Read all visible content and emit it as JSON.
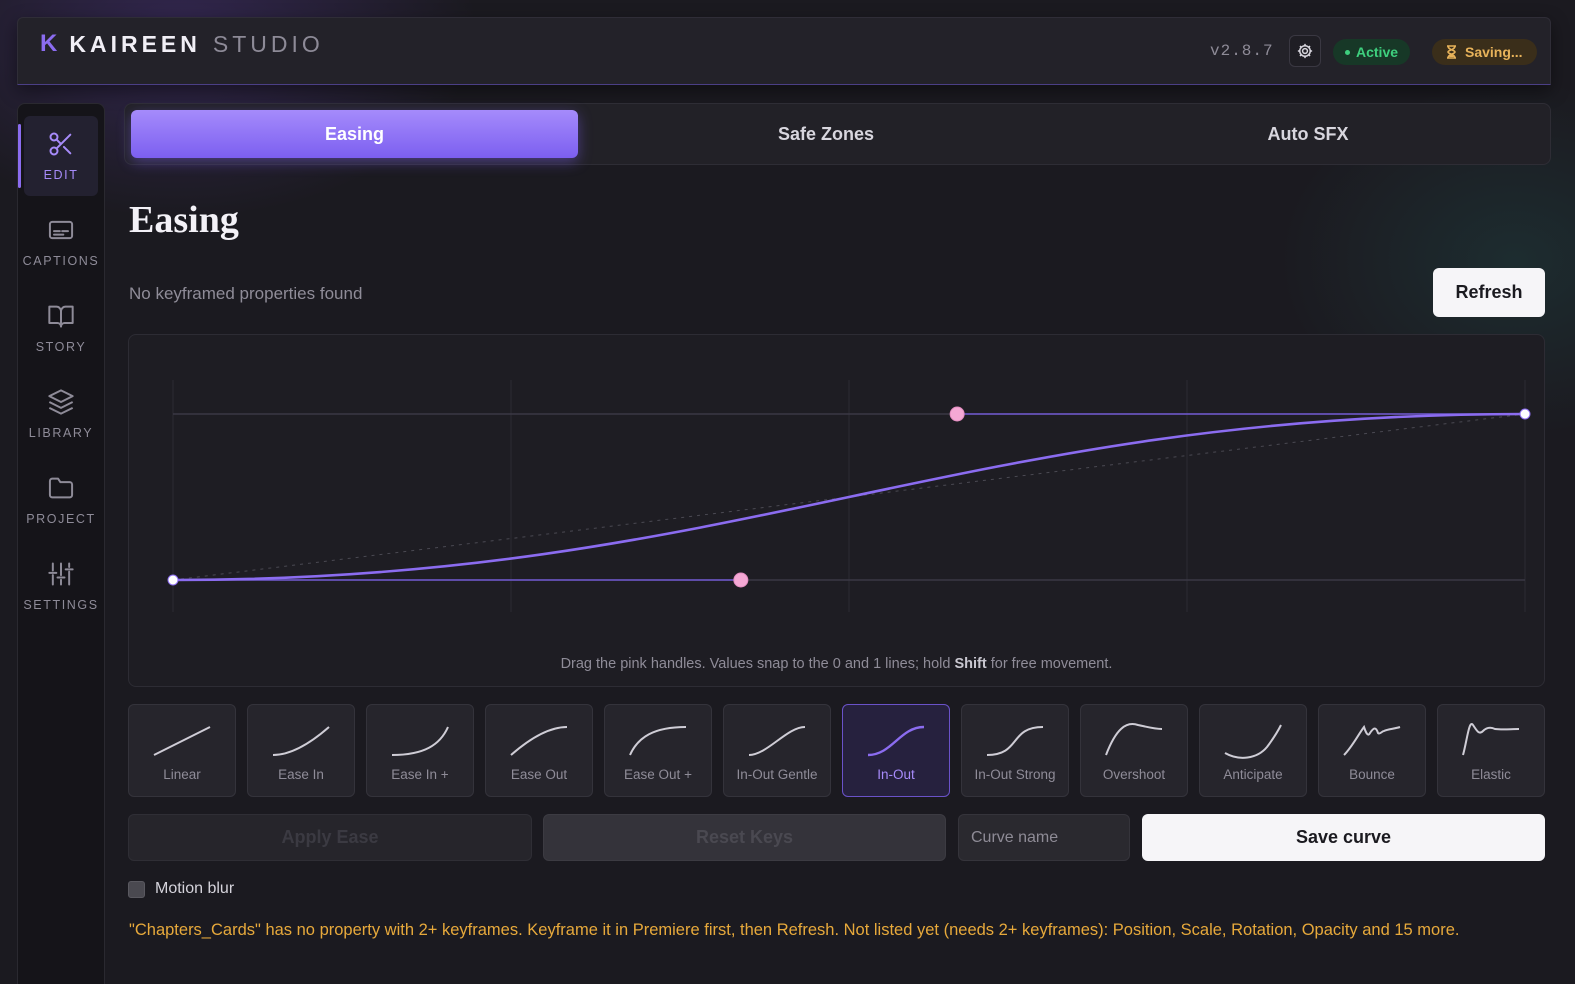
{
  "app": {
    "brand_initial": "K",
    "brand_name": "KAIREEN",
    "brand_suffix": "STUDIO",
    "version": "v2.8.7",
    "status_active": "Active",
    "status_saving": "Saving..."
  },
  "sidebar": {
    "items": [
      {
        "label": "EDIT",
        "icon": "scissors-icon",
        "active": true
      },
      {
        "label": "CAPTIONS",
        "icon": "captions-icon",
        "active": false
      },
      {
        "label": "STORY",
        "icon": "book-icon",
        "active": false
      },
      {
        "label": "LIBRARY",
        "icon": "layers-icon",
        "active": false
      },
      {
        "label": "PROJECT",
        "icon": "folder-icon",
        "active": false
      },
      {
        "label": "SETTINGS",
        "icon": "sliders-icon",
        "active": false
      }
    ]
  },
  "tabs": [
    {
      "label": "Easing",
      "active": true
    },
    {
      "label": "Safe Zones",
      "active": false
    },
    {
      "label": "Auto SFX",
      "active": false
    }
  ],
  "main": {
    "title": "Easing",
    "status": "No keyframed properties found",
    "refresh_label": "Refresh"
  },
  "editor": {
    "hint_before": "Drag the pink handles. Values snap to the 0 and 1 lines; hold ",
    "hint_key": "Shift",
    "hint_after": " for free movement.",
    "curve": {
      "x1": 0.42,
      "y1": 0.0,
      "x2": 0.58,
      "y2": 1.0
    },
    "colors": {
      "curve": "#8b6cf0",
      "handle": "#f4a8d4"
    }
  },
  "presets": [
    {
      "label": "Linear",
      "icon": "linear-curve-icon",
      "active": false
    },
    {
      "label": "Ease In",
      "icon": "ease-in-curve-icon",
      "active": false
    },
    {
      "label": "Ease In +",
      "icon": "ease-in-plus-curve-icon",
      "active": false
    },
    {
      "label": "Ease Out",
      "icon": "ease-out-curve-icon",
      "active": false
    },
    {
      "label": "Ease Out +",
      "icon": "ease-out-plus-curve-icon",
      "active": false
    },
    {
      "label": "In-Out Gentle",
      "icon": "in-out-gentle-curve-icon",
      "active": false
    },
    {
      "label": "In-Out",
      "icon": "in-out-curve-icon",
      "active": true
    },
    {
      "label": "In-Out Strong",
      "icon": "in-out-strong-curve-icon",
      "active": false
    },
    {
      "label": "Overshoot",
      "icon": "overshoot-curve-icon",
      "active": false
    },
    {
      "label": "Anticipate",
      "icon": "anticipate-curve-icon",
      "active": false
    },
    {
      "label": "Bounce",
      "icon": "bounce-curve-icon",
      "active": false
    },
    {
      "label": "Elastic",
      "icon": "elastic-curve-icon",
      "active": false
    }
  ],
  "actions": {
    "apply_label": "Apply Ease",
    "reset_label": "Reset Keys",
    "curve_name_placeholder": "Curve name",
    "save_label": "Save curve"
  },
  "options": {
    "motion_blur_label": "Motion blur",
    "motion_blur_checked": false
  },
  "warning": "\"Chapters_Cards\" has no property with 2+ keyframes. Keyframe it in Premiere first, then Refresh. Not listed yet (needs 2+ keyframes): Position, Scale, Rotation, Opacity and 15 more."
}
